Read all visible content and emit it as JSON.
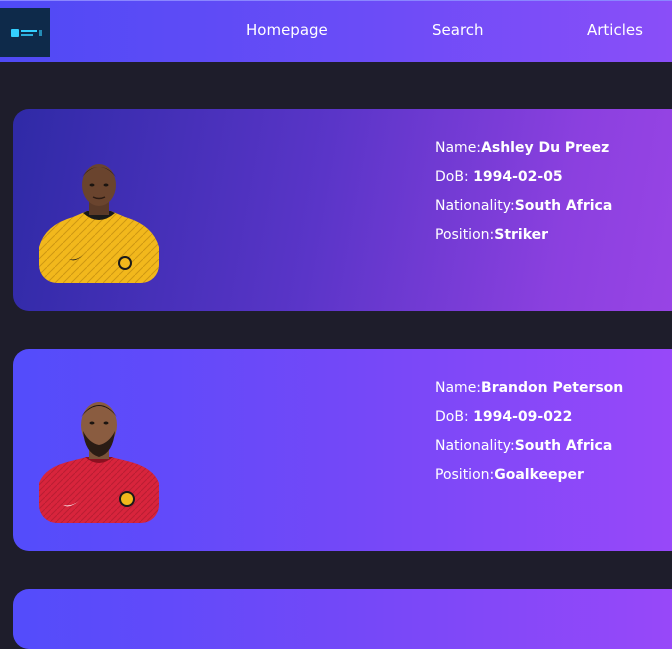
{
  "nav": {
    "logo_text": "Player Base",
    "links": [
      "Homepage",
      "Search",
      "Articles"
    ]
  },
  "players": [
    {
      "labels": {
        "name": "Name:",
        "dob": "DoB: ",
        "nationality": "Nationality:",
        "position": "Position:"
      },
      "name": "Ashley Du Preez",
      "dob": "1994-02-05",
      "nationality": "South Africa",
      "position": "Striker",
      "kit_color": "#f2b81c"
    },
    {
      "labels": {
        "name": "Name:",
        "dob": "DoB: ",
        "nationality": "Nationality:",
        "position": "Position:"
      },
      "name": "Brandon Peterson",
      "dob": "1994-09-022",
      "nationality": "South Africa",
      "position": "Goalkeeper",
      "kit_color": "#d8243c"
    }
  ],
  "colors": {
    "background": "#1e1d2b",
    "nav_start": "#4f4af5",
    "nav_end": "#8a4ef8"
  }
}
